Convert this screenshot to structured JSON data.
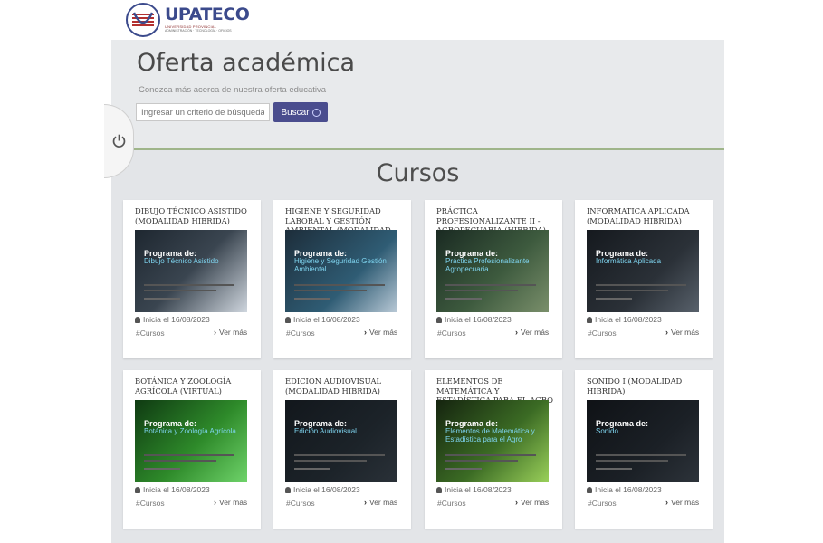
{
  "logo": {
    "name": "UPATECO",
    "sub": "UNIVERSIDAD PROVINCIAL",
    "sub2": "ADMINISTRACIÓN · TECNOLOGÍA · OFICIOS"
  },
  "hero": {
    "title": "Oferta académica",
    "subtitle": "Conozca más acerca de nuestra oferta educativa",
    "search_placeholder": "Ingresar un criterio de búsqueda",
    "search_button": "Buscar"
  },
  "section_title": "Cursos",
  "colors": {
    "button": "#4a4d8e",
    "accent_line": "#9fb58a",
    "program_text": "#7fd5f0"
  },
  "cards": [
    {
      "title": "DIBUJO TÉCNICO ASISTIDO (MODALIDAD HIBRIDA)",
      "img_head": "Programa de:",
      "img_program": "Dibujo Técnico Asistido",
      "date": "Inicia el 16/08/2023",
      "tag": "#Cursos",
      "more": "Ver más"
    },
    {
      "title": "HIGIENE Y SEGURIDAD LABORAL Y GESTIÓN AMBIENTAL (MODALIDAD HIBRIDA)",
      "img_head": "Programa de:",
      "img_program": "Higiene y Seguridad Gestión Ambiental",
      "date": "Inicia el 16/08/2023",
      "tag": "#Cursos",
      "more": "Ver más"
    },
    {
      "title": "PRÁCTICA PROFESIONALIZANTE II - AGROPECUARIA (HIBRIDA)",
      "img_head": "Programa de:",
      "img_program": "Práctica Profesionalizante Agropecuaria",
      "date": "Inicia el 16/08/2023",
      "tag": "#Cursos",
      "more": "Ver más"
    },
    {
      "title": "INFORMATICA APLICADA (MODALIDAD HIBRIDA)",
      "img_head": "Programa de:",
      "img_program": "Informática Aplicada",
      "date": "Inicia el 16/08/2023",
      "tag": "#Cursos",
      "more": "Ver más"
    },
    {
      "title": "BOTÁNICA Y ZOOLOGÍA AGRÍCOLA (VIRTUAL)",
      "img_head": "Programa de:",
      "img_program": "Botánica y Zoología Agrícola",
      "date": "Inicia el 16/08/2023",
      "tag": "#Cursos",
      "more": "Ver más"
    },
    {
      "title": "EDICION AUDIOVISUAL (MODALIDAD HIBRIDA)",
      "img_head": "Programa de:",
      "img_program": "Edición Audiovisual",
      "date": "Inicia el 16/08/2023",
      "tag": "#Cursos",
      "more": "Ver más"
    },
    {
      "title": "ELEMENTOS DE MATEMÁTICA Y ESTADÍSTICA PARA EL AGRO (VIRTUAL)",
      "img_head": "Programa de:",
      "img_program": "Elementos de Matemática y Estadística para el Agro",
      "date": "Inicia el 16/08/2023",
      "tag": "#Cursos",
      "more": "Ver más"
    },
    {
      "title": "SONIDO I (MODALIDAD HIBRIDA)",
      "img_head": "Programa de:",
      "img_program": "Sonido",
      "date": "Inicia el 16/08/2023",
      "tag": "#Cursos",
      "more": "Ver más"
    }
  ]
}
